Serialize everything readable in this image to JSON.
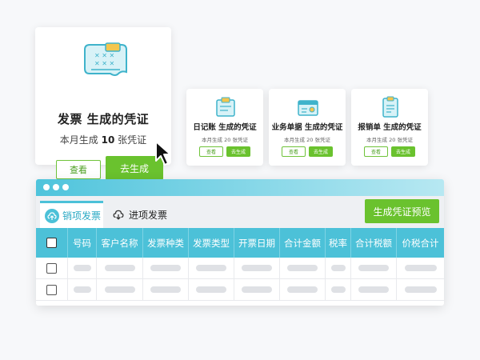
{
  "main_card": {
    "title": "发票 生成的凭证",
    "subtitle_prefix": "本月生成",
    "count": "10",
    "subtitle_suffix": "张凭证",
    "view_label": "查看",
    "generate_label": "去生成",
    "icon": "invoice-icon"
  },
  "mini_cards": [
    {
      "title": "日记账 生成的凭证",
      "sub": "本月生成 20 张凭证",
      "view": "查看",
      "generate": "去生成",
      "icon": "journal-icon"
    },
    {
      "title": "业务单据 生成的凭证",
      "sub": "本月生成 20 张凭证",
      "view": "查看",
      "generate": "去生成",
      "icon": "business-document-icon"
    },
    {
      "title": "报销单 生成的凭证",
      "sub": "本月生成 20 张凭证",
      "view": "查看",
      "generate": "去生成",
      "icon": "reimbursement-icon"
    }
  ],
  "window": {
    "tabs": [
      {
        "label": "销项发票",
        "icon": "upload-cloud-icon",
        "active": true
      },
      {
        "label": "进项发票",
        "icon": "download-cloud-icon",
        "active": false
      }
    ],
    "preview_button": "生成凭证预览",
    "columns": [
      "号码",
      "客户名称",
      "发票种类",
      "发票类型",
      "开票日期",
      "合计金额",
      "税率",
      "合计税额",
      "价税合计"
    ],
    "row_count": 2
  },
  "colors": {
    "accent_cyan": "#4cc1d8",
    "accent_green": "#6ac22e"
  }
}
